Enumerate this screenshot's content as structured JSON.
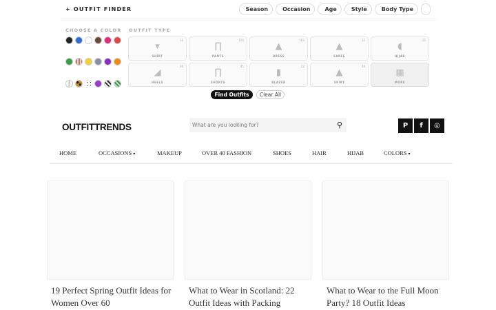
{
  "finder": {
    "title": "+ OUTFIT FINDER",
    "chips": [
      {
        "icon": "",
        "label": "Season"
      },
      {
        "icon": "",
        "label": "Occasion"
      },
      {
        "icon": "",
        "label": "Age"
      },
      {
        "icon": "",
        "label": "Style"
      },
      {
        "icon": "",
        "label": "Body Type"
      },
      {
        "icon": "",
        "label": ""
      }
    ],
    "color_label": "CHOOSE A COLOR",
    "type_label": "OUTFIT TYPE",
    "colors_row1": [
      "#222222",
      "#2b6fd6",
      "#ffffff",
      "#6b4a3a",
      "#e0297a",
      "#e04848"
    ],
    "colors_row2": [
      "#3a9b48",
      "#b07a6a",
      "#f2d230",
      "#8792a0",
      "#8a2ec2",
      "#f08a12"
    ],
    "colors_row3": [
      "#ffffff",
      "#c8882a",
      "#ffffff",
      "#9a3ad0",
      "#222222",
      "#3a8a4a"
    ],
    "types": [
      {
        "name": "SHIRT",
        "count": "16",
        "glyph": "▾"
      },
      {
        "name": "PANTS",
        "count": "124",
        "glyph": "∏"
      },
      {
        "name": "DRESS",
        "count": "183",
        "glyph": "▲"
      },
      {
        "name": "SAREE",
        "count": "15",
        "glyph": "▲"
      },
      {
        "name": "HIJAB",
        "count": "25",
        "glyph": "◖"
      },
      {
        "name": "HEELS",
        "count": "26",
        "glyph": "◢"
      },
      {
        "name": "SHORTS",
        "count": "45",
        "glyph": "∏"
      },
      {
        "name": "BLAZER",
        "count": "22",
        "glyph": "▮"
      },
      {
        "name": "SKIRT",
        "count": "48",
        "glyph": "▲"
      },
      {
        "name": "MORE",
        "count": "",
        "glyph": "▦"
      }
    ],
    "find_label": "Find Outfits",
    "clear_label": "Clear All"
  },
  "header": {
    "logo": "OUTFITTRENDS",
    "search_placeholder": "What are you looking for?",
    "social": [
      "P",
      "f",
      "◎"
    ],
    "nav": [
      {
        "label": "HOME",
        "caret": ""
      },
      {
        "label": "OCCASIONS",
        "caret": "▾"
      },
      {
        "label": "MAKEUP",
        "caret": ""
      },
      {
        "label": "OVER 40 FASHION",
        "caret": ""
      },
      {
        "label": "SHOES",
        "caret": ""
      },
      {
        "label": "HAIR",
        "caret": ""
      },
      {
        "label": "HIJAB",
        "caret": ""
      },
      {
        "label": "COLORS",
        "caret": "▾"
      }
    ]
  },
  "articles": [
    {
      "title": "19 Perfect Spring Outfit Ideas for Women Over 60"
    },
    {
      "title": "What to Wear in Scotland: 22 Outfit Ideas with Packing"
    },
    {
      "title": "What to Wear to the Full Moon Party? 18 Outfit Ideas"
    }
  ]
}
